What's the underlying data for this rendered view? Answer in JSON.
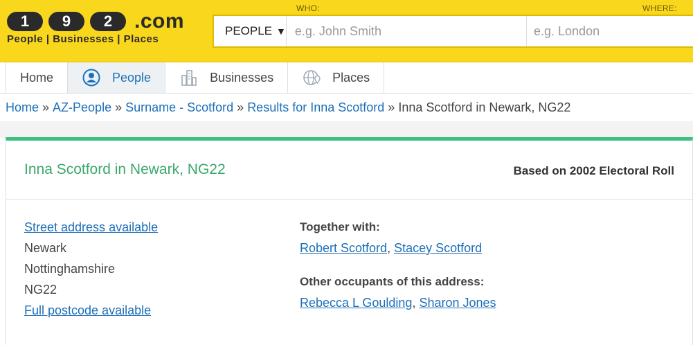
{
  "logo": {
    "digits": [
      "1",
      "9",
      "2"
    ],
    "domain": ".com",
    "tagline": "People | Businesses | Places"
  },
  "search": {
    "who_label": "WHO:",
    "where_label": "WHERE:",
    "type_selected": "PEOPLE",
    "who_placeholder": "e.g. John Smith",
    "where_placeholder": "e.g. London"
  },
  "nav": {
    "tabs": [
      {
        "label": "Home",
        "icon": "none",
        "active": false
      },
      {
        "label": "People",
        "icon": "person-icon",
        "active": true
      },
      {
        "label": "Businesses",
        "icon": "buildings-icon",
        "active": false
      },
      {
        "label": "Places",
        "icon": "globe-pin-icon",
        "active": false
      }
    ]
  },
  "breadcrumb": {
    "items": [
      "Home",
      "AZ-People",
      "Surname - Scotford",
      "Results for Inna Scotford"
    ],
    "current": "Inna Scotford in Newark, NG22",
    "separator": "»"
  },
  "record": {
    "title": "Inna Scotford in Newark, NG22",
    "source_note": "Based on 2002 Electoral Roll",
    "address": {
      "street_link": "Street address available",
      "town": "Newark",
      "county": "Nottinghamshire",
      "postcode_area": "NG22",
      "postcode_link": "Full postcode available"
    },
    "together_with": {
      "heading": "Together with:",
      "people": [
        "Robert Scotford",
        "Stacey Scotford"
      ]
    },
    "other_occupants": {
      "heading": "Other occupants of this address:",
      "people": [
        "Rebecca L Goulding",
        "Sharon Jones"
      ]
    }
  },
  "colors": {
    "header_yellow": "#f9d71c",
    "link_blue": "#1d6fb8",
    "accent_green": "#3dbf7f",
    "title_green": "#3aa86b"
  }
}
